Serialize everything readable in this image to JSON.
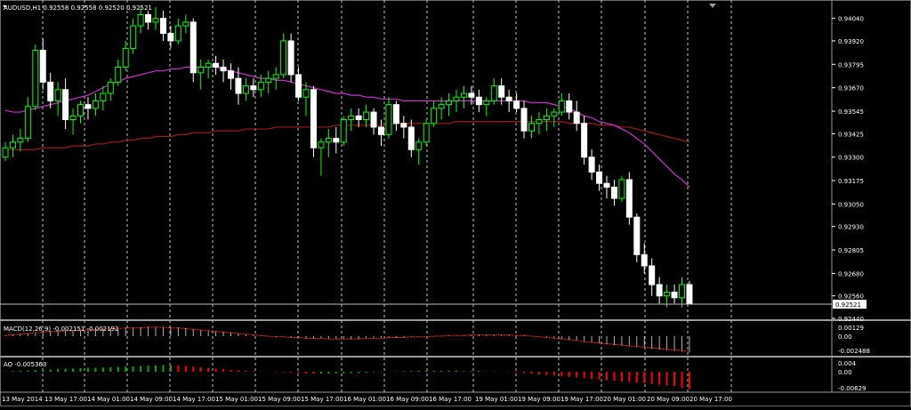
{
  "colors": {
    "background": "#000000",
    "foreground": "#ffffff",
    "grid": "#bfbfbf",
    "bull": "#00ff00",
    "bear": "#ffffff",
    "ma_fast": "#cc33cc",
    "ma_slow": "#a01a1a",
    "macd_signal": "#ff2020",
    "ao_up": "#00b000",
    "ao_down": "#ff0000",
    "price_line": "#c0c0c0"
  },
  "main_panel": {
    "title": "AUDUSD,H1  0.92558 0.92558 0.92520 0.92521",
    "current_price_label": "0.92521",
    "price_ticks": [
      "0.94040",
      "0.93920",
      "0.93795",
      "0.93670",
      "0.93545",
      "0.93425",
      "0.93300",
      "0.93175",
      "0.93050",
      "0.92930",
      "0.92805",
      "0.92680",
      "0.92560",
      "0.92440"
    ]
  },
  "macd_panel": {
    "title": "MACD(12,26,9) -0.002151 -0.002192",
    "ticks": [
      "0.00129",
      "0.00",
      "-0.002488"
    ]
  },
  "ao_panel": {
    "title": "AO -0.005363",
    "ticks": [
      "0.004",
      "0.00",
      "-0.00629"
    ]
  },
  "time_labels": [
    "13 May 2014",
    "13 May 17:00",
    "14 May 01:00",
    "14 May 09:00",
    "14 May 17:00",
    "15 May 01:00",
    "15 May 09:00",
    "15 May 17:00",
    "16 May 01:00",
    "16 May 09:00",
    "16 May 17:00",
    "19 May 01:00",
    "19 May 09:00",
    "19 May 17:00",
    "20 May 01:00",
    "20 May 09:00",
    "20 May 17:00"
  ],
  "chart_data": {
    "type": "candlestick",
    "symbol": "AUDUSD",
    "timeframe": "H1",
    "ylim": [
      0.9244,
      0.941
    ],
    "candles": [
      [
        0.933,
        0.9338,
        0.9328,
        0.9335
      ],
      [
        0.9335,
        0.9342,
        0.933,
        0.9338
      ],
      [
        0.9338,
        0.9345,
        0.9333,
        0.934
      ],
      [
        0.934,
        0.9362,
        0.9338,
        0.9357
      ],
      [
        0.9357,
        0.939,
        0.9355,
        0.9387
      ],
      [
        0.9387,
        0.9393,
        0.9366,
        0.937
      ],
      [
        0.937,
        0.9375,
        0.9356,
        0.936
      ],
      [
        0.936,
        0.937,
        0.9352,
        0.9366
      ],
      [
        0.9366,
        0.9372,
        0.9345,
        0.935
      ],
      [
        0.935,
        0.9356,
        0.9342,
        0.9352
      ],
      [
        0.9352,
        0.936,
        0.9348,
        0.9358
      ],
      [
        0.9358,
        0.9362,
        0.935,
        0.9356
      ],
      [
        0.9356,
        0.9364,
        0.9352,
        0.936
      ],
      [
        0.936,
        0.9368,
        0.9355,
        0.9364
      ],
      [
        0.9364,
        0.9372,
        0.936,
        0.937
      ],
      [
        0.937,
        0.9382,
        0.9368,
        0.9378
      ],
      [
        0.9378,
        0.9392,
        0.9376,
        0.9388
      ],
      [
        0.9388,
        0.9404,
        0.9385,
        0.94
      ],
      [
        0.94,
        0.941,
        0.9396,
        0.9406
      ],
      [
        0.9406,
        0.9408,
        0.9398,
        0.9402
      ],
      [
        0.9402,
        0.941,
        0.9398,
        0.9404
      ],
      [
        0.9404,
        0.9408,
        0.9392,
        0.9396
      ],
      [
        0.9396,
        0.94,
        0.9388,
        0.9392
      ],
      [
        0.9392,
        0.9404,
        0.939,
        0.94
      ],
      [
        0.94,
        0.9406,
        0.9396,
        0.9402
      ],
      [
        0.9402,
        0.9404,
        0.937,
        0.9375
      ],
      [
        0.9375,
        0.9382,
        0.9366,
        0.9378
      ],
      [
        0.9378,
        0.9382,
        0.9372,
        0.938
      ],
      [
        0.938,
        0.9384,
        0.9374,
        0.9378
      ],
      [
        0.9378,
        0.9382,
        0.937,
        0.9376
      ],
      [
        0.9376,
        0.938,
        0.9366,
        0.9372
      ],
      [
        0.9372,
        0.9378,
        0.9358,
        0.9364
      ],
      [
        0.9364,
        0.9372,
        0.936,
        0.9368
      ],
      [
        0.9368,
        0.9372,
        0.9362,
        0.9366
      ],
      [
        0.9366,
        0.9374,
        0.9362,
        0.937
      ],
      [
        0.937,
        0.9376,
        0.9364,
        0.9372
      ],
      [
        0.9372,
        0.9378,
        0.9366,
        0.9374
      ],
      [
        0.9374,
        0.9396,
        0.9372,
        0.9392
      ],
      [
        0.9392,
        0.9396,
        0.937,
        0.9374
      ],
      [
        0.9374,
        0.9378,
        0.936,
        0.9362
      ],
      [
        0.9362,
        0.937,
        0.9352,
        0.9366
      ],
      [
        0.9366,
        0.9368,
        0.933,
        0.9335
      ],
      [
        0.9335,
        0.934,
        0.932,
        0.9338
      ],
      [
        0.9338,
        0.9345,
        0.933,
        0.934
      ],
      [
        0.934,
        0.9346,
        0.9332,
        0.9338
      ],
      [
        0.9338,
        0.9352,
        0.9336,
        0.935
      ],
      [
        0.935,
        0.9356,
        0.9344,
        0.9352
      ],
      [
        0.9352,
        0.9356,
        0.9346,
        0.935
      ],
      [
        0.935,
        0.9358,
        0.9346,
        0.9354
      ],
      [
        0.9354,
        0.9356,
        0.9342,
        0.9346
      ],
      [
        0.9346,
        0.935,
        0.9336,
        0.9342
      ],
      [
        0.9342,
        0.9362,
        0.934,
        0.9358
      ],
      [
        0.9358,
        0.936,
        0.9344,
        0.9348
      ],
      [
        0.9348,
        0.9352,
        0.934,
        0.9346
      ],
      [
        0.9346,
        0.935,
        0.933,
        0.9334
      ],
      [
        0.9334,
        0.934,
        0.9326,
        0.9338
      ],
      [
        0.9338,
        0.935,
        0.9336,
        0.9348
      ],
      [
        0.9348,
        0.936,
        0.9346,
        0.9356
      ],
      [
        0.9356,
        0.9362,
        0.935,
        0.9358
      ],
      [
        0.9358,
        0.9364,
        0.9352,
        0.936
      ],
      [
        0.936,
        0.9366,
        0.9354,
        0.9362
      ],
      [
        0.9362,
        0.9368,
        0.9356,
        0.9364
      ],
      [
        0.9364,
        0.9368,
        0.9358,
        0.9362
      ],
      [
        0.9362,
        0.9366,
        0.9354,
        0.9358
      ],
      [
        0.9358,
        0.9362,
        0.9352,
        0.936
      ],
      [
        0.936,
        0.9372,
        0.9358,
        0.9368
      ],
      [
        0.9368,
        0.9372,
        0.9358,
        0.9362
      ],
      [
        0.9362,
        0.9366,
        0.9354,
        0.936
      ],
      [
        0.936,
        0.9364,
        0.9354,
        0.9356
      ],
      [
        0.9356,
        0.936,
        0.934,
        0.9344
      ],
      [
        0.9344,
        0.9352,
        0.934,
        0.9348
      ],
      [
        0.9348,
        0.9354,
        0.9342,
        0.935
      ],
      [
        0.935,
        0.9356,
        0.9344,
        0.9352
      ],
      [
        0.9352,
        0.9356,
        0.9346,
        0.9354
      ],
      [
        0.9354,
        0.9364,
        0.9352,
        0.936
      ],
      [
        0.936,
        0.9364,
        0.935,
        0.9354
      ],
      [
        0.9354,
        0.936,
        0.9344,
        0.9348
      ],
      [
        0.9348,
        0.9352,
        0.9326,
        0.933
      ],
      [
        0.933,
        0.9334,
        0.9318,
        0.9322
      ],
      [
        0.9322,
        0.9326,
        0.9312,
        0.9316
      ],
      [
        0.9316,
        0.932,
        0.9308,
        0.9314
      ],
      [
        0.9314,
        0.9318,
        0.9304,
        0.9308
      ],
      [
        0.9308,
        0.932,
        0.9306,
        0.9318
      ],
      [
        0.9318,
        0.9322,
        0.9294,
        0.9298
      ],
      [
        0.9298,
        0.93,
        0.9274,
        0.9278
      ],
      [
        0.9278,
        0.9284,
        0.9268,
        0.9272
      ],
      [
        0.9272,
        0.9276,
        0.9256,
        0.9262
      ],
      [
        0.9262,
        0.9266,
        0.9252,
        0.9256
      ],
      [
        0.9256,
        0.9262,
        0.925,
        0.9258
      ],
      [
        0.9258,
        0.9262,
        0.9252,
        0.9255
      ],
      [
        0.9255,
        0.9266,
        0.925,
        0.9262
      ],
      [
        0.9262,
        0.9264,
        0.9252,
        0.9252
      ]
    ],
    "ma_fast": [
      0.9355,
      0.9354,
      0.9354,
      0.9355,
      0.9356,
      0.9357,
      0.9358,
      0.9359,
      0.936,
      0.9361,
      0.9362,
      0.9363,
      0.9365,
      0.9367,
      0.9369,
      0.937,
      0.9372,
      0.9373,
      0.9374,
      0.9375,
      0.9376,
      0.9376,
      0.9377,
      0.9377,
      0.9378,
      0.9378,
      0.9378,
      0.9378,
      0.9378,
      0.9377,
      0.9376,
      0.9375,
      0.9374,
      0.9373,
      0.9372,
      0.9372,
      0.9371,
      0.9371,
      0.937,
      0.9369,
      0.9368,
      0.9367,
      0.9366,
      0.9365,
      0.9364,
      0.9364,
      0.9363,
      0.9363,
      0.9362,
      0.9362,
      0.9361,
      0.9361,
      0.9361,
      0.936,
      0.936,
      0.936,
      0.936,
      0.936,
      0.936,
      0.936,
      0.936,
      0.936,
      0.936,
      0.936,
      0.936,
      0.936,
      0.936,
      0.936,
      0.936,
      0.936,
      0.9359,
      0.9359,
      0.9359,
      0.9358,
      0.9357,
      0.9356,
      0.9354,
      0.9352,
      0.9351,
      0.9349,
      0.9348,
      0.9347,
      0.9345,
      0.9343,
      0.934,
      0.9337,
      0.9333,
      0.9329,
      0.9325,
      0.9321,
      0.9318,
      0.9314
    ],
    "ma_slow": [
      0.9334,
      0.9334,
      0.9334,
      0.9334,
      0.9334,
      0.9335,
      0.9335,
      0.9335,
      0.9335,
      0.9336,
      0.9336,
      0.9336,
      0.9337,
      0.9337,
      0.9338,
      0.9338,
      0.9339,
      0.9339,
      0.934,
      0.934,
      0.9341,
      0.9341,
      0.9341,
      0.9342,
      0.9342,
      0.9343,
      0.9343,
      0.9343,
      0.9344,
      0.9344,
      0.9344,
      0.9344,
      0.9345,
      0.9345,
      0.9345,
      0.9345,
      0.9346,
      0.9346,
      0.9346,
      0.9346,
      0.9346,
      0.9346,
      0.9346,
      0.9346,
      0.9347,
      0.9347,
      0.9347,
      0.9347,
      0.9347,
      0.9347,
      0.9347,
      0.9347,
      0.9348,
      0.9348,
      0.9348,
      0.9348,
      0.9348,
      0.9348,
      0.9348,
      0.9348,
      0.9349,
      0.9349,
      0.9349,
      0.9349,
      0.9349,
      0.9349,
      0.9349,
      0.9349,
      0.9349,
      0.9349,
      0.9349,
      0.9349,
      0.9349,
      0.9349,
      0.9349,
      0.9348,
      0.9348,
      0.9348,
      0.9348,
      0.9347,
      0.9347,
      0.9347,
      0.9346,
      0.9346,
      0.9345,
      0.9344,
      0.9343,
      0.9342,
      0.9341,
      0.934,
      0.9339,
      0.9338
    ],
    "macd_hist": [
      0.0001,
      0.0002,
      0.0003,
      0.0004,
      0.0005,
      0.0006,
      0.0007,
      0.0007,
      0.0008,
      0.0008,
      0.0009,
      0.0009,
      0.001,
      0.001,
      0.0011,
      0.0011,
      0.0012,
      0.0012,
      0.0012,
      0.0013,
      0.0013,
      0.0013,
      0.0012,
      0.0012,
      0.0011,
      0.001,
      0.0009,
      0.0008,
      0.0007,
      0.0006,
      0.0005,
      0.0004,
      0.0003,
      0.0002,
      0.0001,
      0.0,
      -0.0001,
      -0.0001,
      -0.0002,
      -0.0002,
      -0.0003,
      -0.0003,
      -0.0003,
      -0.0004,
      -0.0004,
      -0.0004,
      -0.0004,
      -0.0004,
      -0.0003,
      -0.0003,
      -0.0003,
      -0.0002,
      -0.0002,
      -0.0002,
      -0.0001,
      -0.0001,
      -0.0001,
      0.0,
      0.0,
      0.0001,
      0.0001,
      0.0001,
      0.0002,
      0.0002,
      0.0002,
      0.0002,
      0.0002,
      0.0002,
      0.0001,
      0.0001,
      0.0,
      -0.0001,
      -0.0002,
      -0.0003,
      -0.0004,
      -0.0005,
      -0.0006,
      -0.0008,
      -0.0009,
      -0.001,
      -0.0011,
      -0.0012,
      -0.0013,
      -0.0014,
      -0.0015,
      -0.0016,
      -0.0017,
      -0.0018,
      -0.0019,
      -0.002,
      -0.0021,
      -0.0022
    ],
    "ao_hist": [
      0.0001,
      0.0002,
      0.0003,
      0.0004,
      0.0005,
      0.0006,
      0.0007,
      0.0008,
      0.0009,
      0.001,
      0.0011,
      0.0012,
      0.0012,
      0.0013,
      0.0014,
      0.0015,
      0.0016,
      0.0017,
      0.0018,
      0.0019,
      0.002,
      0.0021,
      0.0021,
      0.002,
      0.0018,
      0.0016,
      0.0014,
      0.0012,
      0.001,
      0.0008,
      0.0006,
      0.0004,
      0.0003,
      0.0002,
      0.0001,
      0.0,
      -0.0001,
      -0.0002,
      -0.0003,
      -0.0004,
      -0.0005,
      -0.0006,
      -0.0006,
      -0.0006,
      -0.0005,
      -0.0005,
      -0.0004,
      -0.0004,
      -0.0003,
      -0.0002,
      -0.0001,
      0.0,
      0.0001,
      0.0002,
      0.0002,
      0.0003,
      0.0003,
      0.0003,
      0.0003,
      0.0003,
      0.0003,
      0.0002,
      0.0002,
      0.0002,
      0.0001,
      0.0001,
      0.0,
      -0.0001,
      -0.0002,
      -0.0004,
      -0.0006,
      -0.0008,
      -0.001,
      -0.0012,
      -0.0014,
      -0.0016,
      -0.0018,
      -0.002,
      -0.0022,
      -0.0024,
      -0.0026,
      -0.0028,
      -0.003,
      -0.0032,
      -0.0034,
      -0.0036,
      -0.0038,
      -0.004,
      -0.0042,
      -0.0044,
      -0.005,
      -0.0054
    ]
  }
}
